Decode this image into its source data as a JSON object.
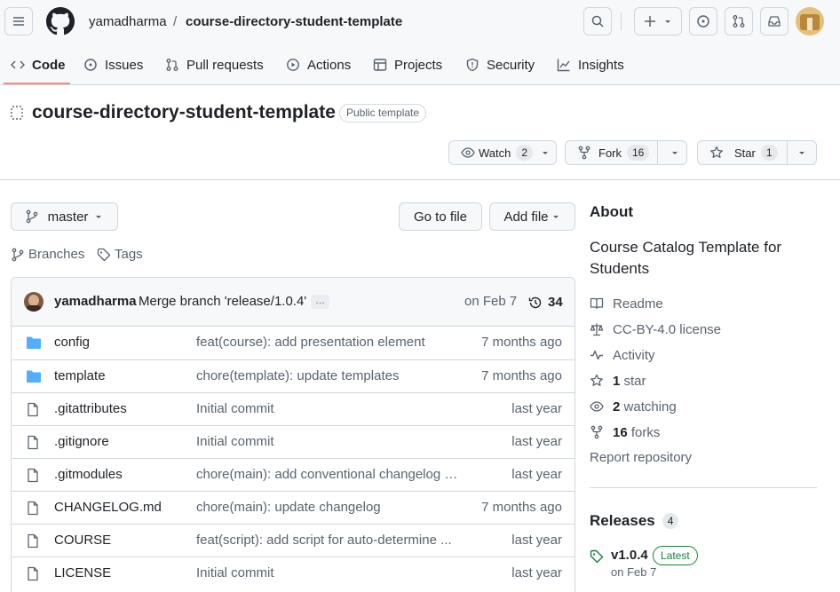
{
  "header": {
    "owner": "yamadharma",
    "separator": "/",
    "repo": "course-directory-student-template"
  },
  "tabs": [
    {
      "label": "Code",
      "icon": "code-icon"
    },
    {
      "label": "Issues",
      "icon": "issue-icon"
    },
    {
      "label": "Pull requests",
      "icon": "pull-request-icon"
    },
    {
      "label": "Actions",
      "icon": "play-icon"
    },
    {
      "label": "Projects",
      "icon": "table-icon"
    },
    {
      "label": "Security",
      "icon": "shield-icon"
    },
    {
      "label": "Insights",
      "icon": "graph-icon"
    }
  ],
  "repo": {
    "title": "course-directory-student-template",
    "visibility": "Public template"
  },
  "actions": {
    "watch_label": "Watch",
    "watch_count": "2",
    "fork_label": "Fork",
    "fork_count": "16",
    "star_label": "Star",
    "star_count": "1"
  },
  "toolbar": {
    "branch": "master",
    "goto_file": "Go to file",
    "add_file": "Add file",
    "branches": "Branches",
    "tags": "Tags"
  },
  "commit": {
    "author": "yamadharma",
    "message": "Merge branch 'release/1.0.4'",
    "ellipsis": "…",
    "date": "on Feb 7",
    "count": "34"
  },
  "files": [
    {
      "name": "config",
      "type": "folder",
      "message": "feat(course): add presentation element",
      "date": "7 months ago"
    },
    {
      "name": "template",
      "type": "folder",
      "message": "chore(template): update templates",
      "date": "7 months ago"
    },
    {
      "name": ".gitattributes",
      "type": "file",
      "message": "Initial commit",
      "date": "last year"
    },
    {
      "name": ".gitignore",
      "type": "file",
      "message": "Initial commit",
      "date": "last year"
    },
    {
      "name": ".gitmodules",
      "type": "file",
      "message": "chore(main): add conventional changelog s...",
      "date": "last year"
    },
    {
      "name": "CHANGELOG.md",
      "type": "file",
      "message": "chore(main): update changelog",
      "date": "7 months ago"
    },
    {
      "name": "COURSE",
      "type": "file",
      "message": "feat(script): add script for auto-determine ...",
      "date": "last year"
    },
    {
      "name": "LICENSE",
      "type": "file",
      "message": "Initial commit",
      "date": "last year"
    }
  ],
  "about": {
    "heading": "About",
    "description": "Course Catalog Template for Students",
    "readme": "Readme",
    "license": "CC-BY-4.0 license",
    "activity": "Activity",
    "stars_count": "1",
    "stars_label": "star",
    "watching_count": "2",
    "watching_label": "watching",
    "forks_count": "16",
    "forks_label": "forks",
    "report": "Report repository"
  },
  "releases": {
    "heading": "Releases",
    "count": "4",
    "version": "v1.0.4",
    "latest": "Latest",
    "date": "on Feb 7"
  },
  "colors": {
    "accent_underline": "#fd8c73",
    "folder": "#54aeff",
    "latest_green": "#1a7f37",
    "muted": "#59636e",
    "border": "#d0d7de"
  }
}
